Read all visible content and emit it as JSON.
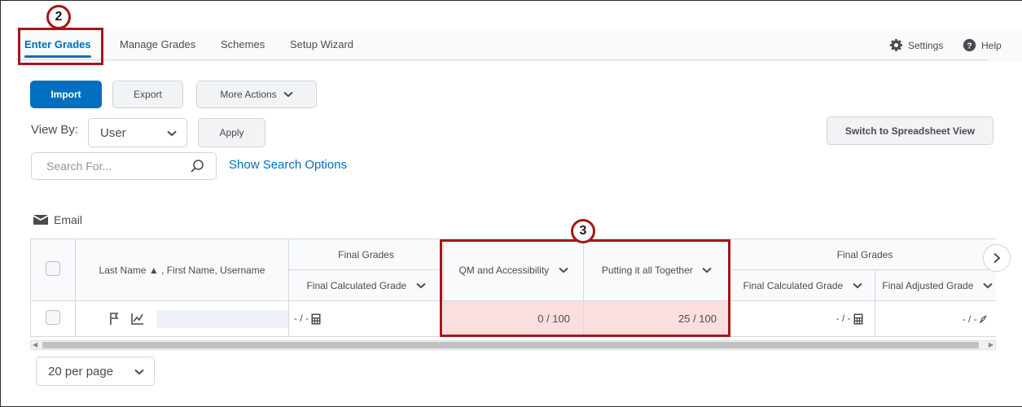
{
  "callouts": {
    "step_top": "2",
    "step_columns": "3"
  },
  "nav": {
    "tabs": [
      {
        "label": "Enter Grades",
        "active": true
      },
      {
        "label": "Manage Grades",
        "active": false
      },
      {
        "label": "Schemes",
        "active": false
      },
      {
        "label": "Setup Wizard",
        "active": false
      }
    ],
    "settings_label": "Settings",
    "help_label": "Help"
  },
  "toolbar": {
    "import_label": "Import",
    "export_label": "Export",
    "more_actions_label": "More Actions"
  },
  "view": {
    "view_by_label": "View By:",
    "view_by_value": "User",
    "apply_label": "Apply",
    "switch_label": "Switch to Spreadsheet View"
  },
  "search": {
    "placeholder": "Search For...",
    "show_options_label": "Show Search Options"
  },
  "email_label": "Email",
  "table": {
    "name_header": "Last Name ▲ , First Name, Username",
    "group1_header": "Final Grades",
    "col_final_calculated": "Final Calculated Grade",
    "col_qm": "QM and Accessibility",
    "col_putting": "Putting it all Together",
    "group2_header": "Final Grades",
    "col_final_calculated_2": "Final Calculated Grade",
    "col_final_adjusted": "Final Adjusted Grade",
    "row": {
      "final_calculated": "- / -",
      "qm_score": "0 / 100",
      "putting_score": "25 / 100",
      "final_calculated_2": "- / -",
      "final_adjusted": "- / -"
    }
  },
  "pagination": {
    "per_page": "20 per page"
  },
  "colors": {
    "accent": "#006fbf",
    "callout": "#a4161a",
    "highlight": "#fddede"
  }
}
